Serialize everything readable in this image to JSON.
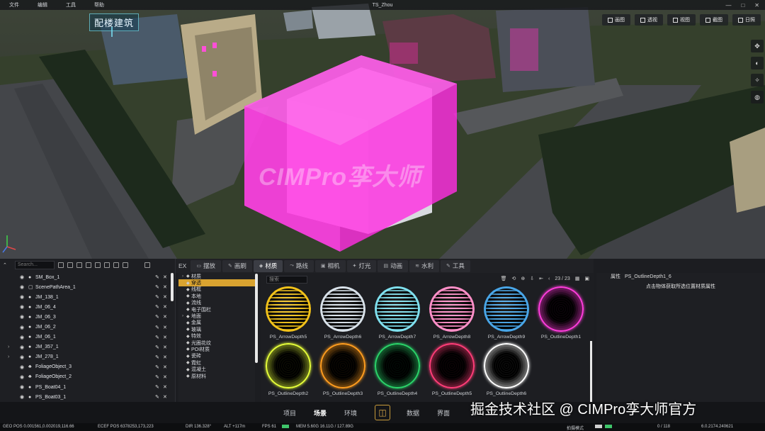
{
  "window": {
    "title": "TS_Zhou",
    "menu": [
      "文件",
      "编辑",
      "工具",
      "帮助"
    ]
  },
  "viewport": {
    "building_label": "配楼建筑",
    "watermark": "CIMPro孪大师",
    "toolbar": [
      {
        "label": "画图",
        "icon": "image-icon"
      },
      {
        "label": "透视",
        "icon": "perspective-icon"
      },
      {
        "label": "视图",
        "icon": "view-icon"
      },
      {
        "label": "截图",
        "icon": "screenshot-icon"
      },
      {
        "label": "日照",
        "icon": "sun-icon"
      }
    ],
    "side_tools": [
      {
        "glyph": "✥",
        "icon": "move-icon"
      },
      {
        "glyph": "◐",
        "icon": "environment-icon"
      },
      {
        "glyph": "✧",
        "icon": "effects-icon"
      },
      {
        "glyph": "◍",
        "icon": "globe-icon"
      }
    ]
  },
  "tabs": [
    {
      "label": "EX",
      "icon": ""
    },
    {
      "label": "摆放",
      "icon": "▭"
    },
    {
      "label": "画刷",
      "icon": "✎"
    },
    {
      "label": "材质",
      "icon": "◈",
      "active": true
    },
    {
      "label": "路线",
      "icon": "⤳"
    },
    {
      "label": "相机",
      "icon": "▣"
    },
    {
      "label": "灯光",
      "icon": "✦"
    },
    {
      "label": "动画",
      "icon": "▤"
    },
    {
      "label": "水利",
      "icon": "≋"
    },
    {
      "label": "工具",
      "icon": "✎"
    }
  ],
  "outliner": {
    "search_placeholder": "Search...",
    "items": [
      {
        "name": "SM_Box_1",
        "expandable": false,
        "icon": "●"
      },
      {
        "name": "ScenePathArea_1",
        "expandable": false,
        "icon": "▢"
      },
      {
        "name": "JM_138_1",
        "expandable": false,
        "icon": "●"
      },
      {
        "name": "JM_06_4",
        "expandable": false,
        "icon": "●"
      },
      {
        "name": "JM_06_3",
        "expandable": false,
        "icon": "●"
      },
      {
        "name": "JM_06_2",
        "expandable": false,
        "icon": "●"
      },
      {
        "name": "JM_06_1",
        "expandable": false,
        "icon": "●"
      },
      {
        "name": "JM_357_1",
        "expandable": true,
        "icon": "●"
      },
      {
        "name": "JM_278_1",
        "expandable": true,
        "icon": "●"
      },
      {
        "name": "FoliageObject_3",
        "expandable": false,
        "icon": "♣"
      },
      {
        "name": "FoliageObject_2",
        "expandable": false,
        "icon": "♣"
      },
      {
        "name": "PS_Boat04_1",
        "expandable": false,
        "icon": "●"
      },
      {
        "name": "PS_Boat03_1",
        "expandable": false,
        "icon": "●"
      }
    ]
  },
  "categories": [
    {
      "label": "材质",
      "expandable": true,
      "selected": false
    },
    {
      "label": "穿透",
      "expandable": false,
      "selected": true
    },
    {
      "label": "线框",
      "expandable": false,
      "selected": false
    },
    {
      "label": "本地",
      "expandable": false,
      "selected": false
    },
    {
      "label": "流线",
      "expandable": false,
      "selected": false
    },
    {
      "label": "电子围栏",
      "expandable": false,
      "selected": false
    },
    {
      "label": "地面",
      "expandable": true,
      "selected": false
    },
    {
      "label": "金属",
      "expandable": false,
      "selected": false
    },
    {
      "label": "玻璃",
      "expandable": false,
      "selected": false
    },
    {
      "label": "特效",
      "expandable": false,
      "selected": false
    },
    {
      "label": "光圈花纹",
      "expandable": false,
      "selected": false
    },
    {
      "label": "POI材质",
      "expandable": false,
      "selected": false
    },
    {
      "label": "瓷砖",
      "expandable": false,
      "selected": false
    },
    {
      "label": "霓虹",
      "expandable": false,
      "selected": false
    },
    {
      "label": "混凝土",
      "expandable": false,
      "selected": false
    },
    {
      "label": "原材料",
      "expandable": false,
      "selected": false
    }
  ],
  "materials": {
    "search_placeholder": "搜索",
    "page": "23 / 23",
    "items": [
      {
        "name": "PS_ArrowDepth5",
        "color": "#f2c21a",
        "style": "arrow"
      },
      {
        "name": "PS_ArrowDepth6",
        "color": "#d9e2ea",
        "style": "arrow"
      },
      {
        "name": "PS_ArrowDepth7",
        "color": "#7fe0ee",
        "style": "arrow"
      },
      {
        "name": "PS_ArrowDepth8",
        "color": "#ff8fc8",
        "style": "arrow"
      },
      {
        "name": "PS_ArrowDepth9",
        "color": "#49a6e8",
        "style": "arrow"
      },
      {
        "name": "PS_OutlineDepth1",
        "color": "#ff3ddc",
        "style": "outline"
      },
      {
        "name": "PS_OutlineDepth2",
        "color": "#e6ff3a",
        "style": "outline"
      },
      {
        "name": "PS_OutlineDepth3",
        "color": "#ff9d1f",
        "style": "outline"
      },
      {
        "name": "PS_OutlineDepth4",
        "color": "#2bd46a",
        "style": "outline"
      },
      {
        "name": "PS_OutlineDepth5",
        "color": "#ff3d78",
        "style": "outline"
      },
      {
        "name": "PS_OutlineDepth6",
        "color": "#ffffff",
        "style": "outline"
      }
    ]
  },
  "properties": {
    "title": "属性",
    "object": "PS_OutlineDepth1_6",
    "hint": "点击物体获取所选位置材质属性"
  },
  "nav": [
    {
      "label": "项目",
      "active": false
    },
    {
      "label": "场景",
      "active": true
    },
    {
      "label": "环境",
      "active": false
    },
    {
      "label": "数据",
      "active": false
    },
    {
      "label": "界面",
      "active": false
    }
  ],
  "credit": "掘金技术社区 @ CIMPro孪大师官方",
  "status": {
    "geo_pos": "GEO POS  0.001561,0.002019,116.66",
    "ecef_pos": "ECEF POS  6378253,173,223",
    "dir": "DIR  136.328°",
    "alt": "ALT  +117m",
    "fps": "FPS  61",
    "mem": "MEM  5.60G  16.11G / 127.89G",
    "render_mode": "拍摄模式",
    "count": "0 / 118",
    "version": "6.0.2174.240621"
  },
  "colors": {
    "accent": "#d9a330",
    "highlight_box": "#ff2ee0",
    "active_tab": "#3b3d44"
  }
}
